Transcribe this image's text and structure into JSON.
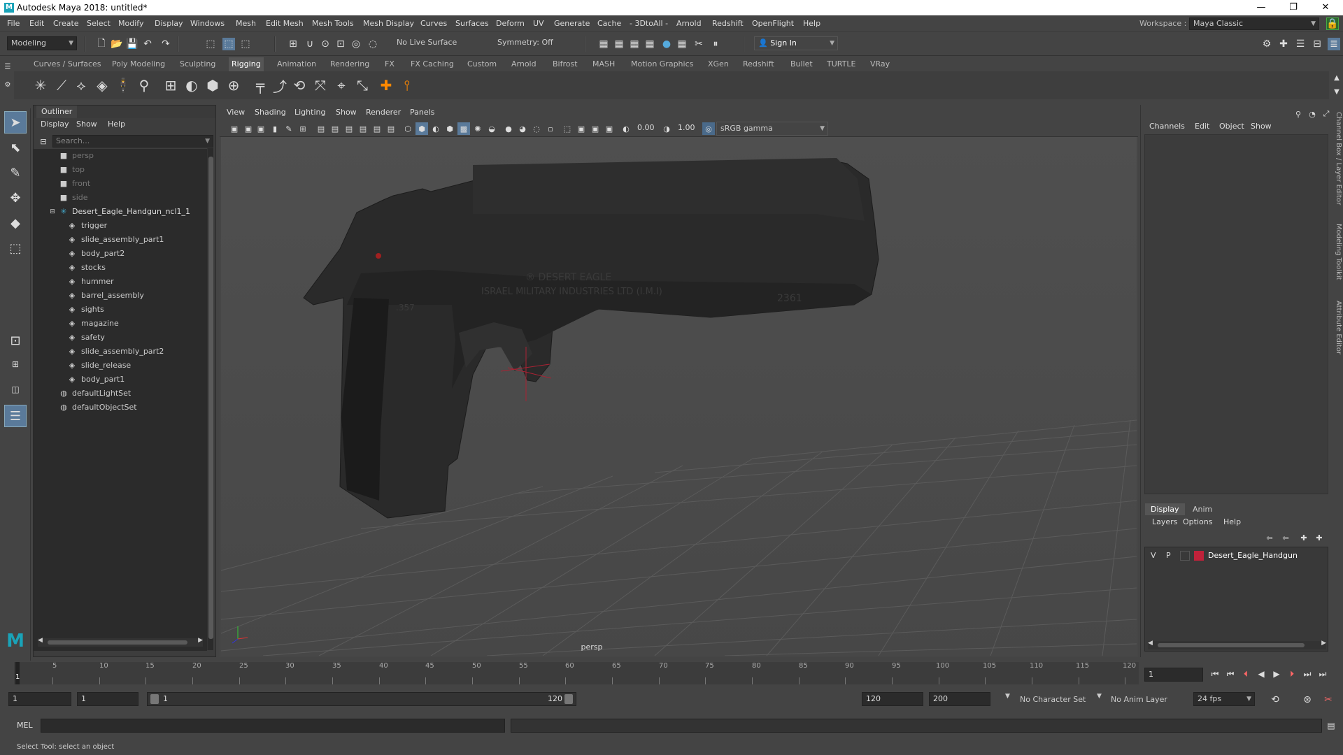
{
  "window": {
    "title": "Autodesk Maya 2018: untitled*",
    "minimize": "—",
    "restore": "❐",
    "close": "✕"
  },
  "menubar": [
    "File",
    "Edit",
    "Create",
    "Select",
    "Modify",
    "Display",
    "Windows",
    "Mesh",
    "Edit Mesh",
    "Mesh Tools",
    "Mesh Display",
    "Curves",
    "Surfaces",
    "Deform",
    "UV",
    "Generate",
    "Cache",
    "- 3DtoAll -",
    "Arnold",
    "Redshift",
    "OpenFlight",
    "Help"
  ],
  "workspace": {
    "label": "Workspace :",
    "value": "Maya Classic"
  },
  "statusline": {
    "mode": "Modeling",
    "live_surface": "No Live Surface",
    "symmetry": "Symmetry: Off",
    "sign_in": "Sign In"
  },
  "shelf_tabs": [
    "Curves / Surfaces",
    "Poly Modeling",
    "Sculpting",
    "Rigging",
    "Animation",
    "Rendering",
    "FX",
    "FX Caching",
    "Custom",
    "Arnold",
    "Bifrost",
    "MASH",
    "Motion Graphics",
    "XGen",
    "Redshift",
    "Bullet",
    "TURTLE",
    "VRay"
  ],
  "shelf_active": "Rigging",
  "outliner": {
    "tab": "Outliner",
    "menu": [
      "Display",
      "Show",
      "Help"
    ],
    "search_placeholder": "Search...",
    "cameras": [
      "persp",
      "top",
      "front",
      "side"
    ],
    "group": "Desert_Eagle_Handgun_ncl1_1",
    "children": [
      "trigger",
      "slide_assembly_part1",
      "body_part2",
      "stocks",
      "hummer",
      "barrel_assembly",
      "sights",
      "magazine",
      "safety",
      "slide_assembly_part2",
      "slide_release",
      "body_part1"
    ],
    "sets": [
      "defaultLightSet",
      "defaultObjectSet"
    ]
  },
  "viewport": {
    "menu": [
      "View",
      "Shading",
      "Lighting",
      "Show",
      "Renderer",
      "Panels"
    ],
    "exposure": "0.00",
    "gamma": "1.00",
    "color_space": "sRGB gamma",
    "camera_label": "persp",
    "engraving_line1": "® DESERT EAGLE",
    "engraving_line2": "ISRAEL MILITARY INDUSTRIES LTD (I.M.I)",
    "engraving_caliber": ".357",
    "engraving_serial": "2361"
  },
  "channelbox": {
    "menu": [
      "Channels",
      "Edit",
      "Object",
      "Show"
    ],
    "layer_tabs": [
      "Display",
      "Anim"
    ],
    "layer_tab_active": "Display",
    "layer_menu": [
      "Layers",
      "Options",
      "Help"
    ],
    "layer": {
      "v": "V",
      "p": "P",
      "name": "Desert_Eagle_Handgun",
      "color": "#c0223a"
    },
    "side_labels": [
      "Channel Box / Layer Editor",
      "Modeling Toolkit",
      "Attribute Editor"
    ]
  },
  "timeline": {
    "ticks": [
      "1",
      "5",
      "10",
      "15",
      "20",
      "25",
      "30",
      "35",
      "40",
      "45",
      "50",
      "55",
      "60",
      "65",
      "70",
      "75",
      "80",
      "85",
      "90",
      "95",
      "100",
      "105",
      "110",
      "115",
      "120"
    ],
    "current_frame": "1"
  },
  "range": {
    "start": "1",
    "playback_start": "1",
    "slider_start": "1",
    "slider_end": "120",
    "playback_end": "120",
    "end": "200",
    "character_set": "No Character Set",
    "anim_layer": "No Anim Layer",
    "fps": "24 fps"
  },
  "cmdline": {
    "label": "MEL"
  },
  "helpline": {
    "text": "Select Tool: select an object"
  }
}
